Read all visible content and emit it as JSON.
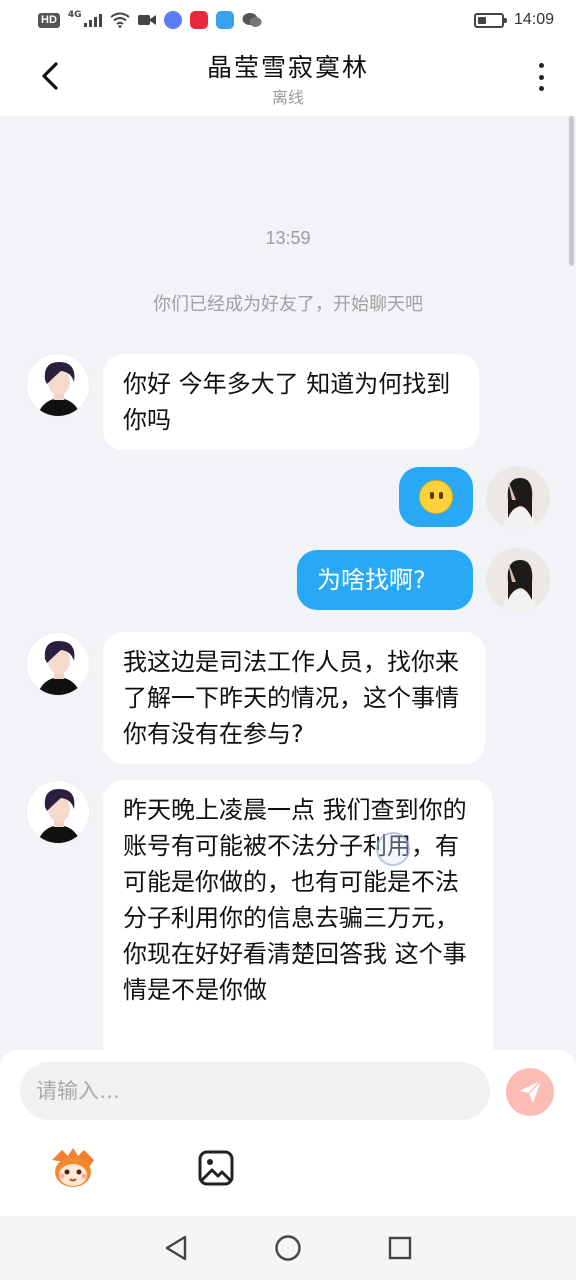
{
  "status_bar": {
    "hd_label": "HD",
    "network_label": "4G",
    "time": "14:09",
    "battery_level": 0.35
  },
  "header": {
    "title": "晶莹雪寂寞林",
    "subtitle": "离线"
  },
  "chat": {
    "timestamp": "13:59",
    "system_message": "你们已经成为好友了，开始聊天吧",
    "messages": [
      {
        "sender": "them",
        "text": "你好 今年多大了 知道为何找到你吗"
      },
      {
        "sender": "me",
        "type": "emoji",
        "emoji": "speechless-face-emoji"
      },
      {
        "sender": "me",
        "text": "为啥找啊?"
      },
      {
        "sender": "them",
        "text": "我这边是司法工作人员，找你来了解一下昨天的情况，这个事情你有没有在参与?"
      },
      {
        "sender": "them",
        "text": "昨天晚上凌晨一点 我们查到你的账号有可能被不法分子利用，有可能是你做的，也有可能是不法分子利用你的信息去骗三万元，你现在好好看清楚回答我 这个事情是不是你做"
      }
    ]
  },
  "input": {
    "placeholder": "请输入…",
    "value": ""
  },
  "colors": {
    "my_bubble": "#29a9f5",
    "their_bubble": "#ffffff",
    "chat_background": "#f2f3f7",
    "send_button": "#fbbcb6"
  },
  "icons": {
    "back": "chevron-left-icon",
    "more": "more-vertical-icon",
    "send": "paper-plane-icon",
    "mascot": "mascot-sticker-icon",
    "image": "image-icon",
    "nav_back": "triangle-back-icon",
    "nav_home": "circle-home-icon",
    "nav_recent": "square-recent-icon"
  }
}
